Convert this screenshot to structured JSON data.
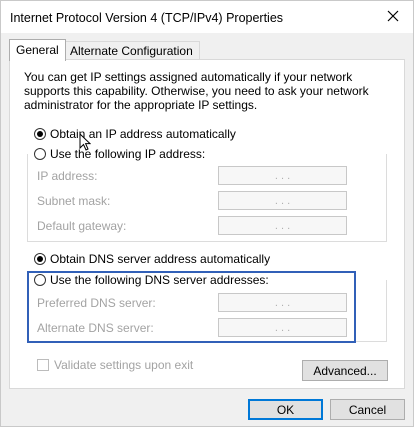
{
  "window": {
    "title": "Internet Protocol Version 4 (TCP/IPv4) Properties"
  },
  "tabs": [
    {
      "label": "General",
      "active": true
    },
    {
      "label": "Alternate Configuration",
      "active": false
    }
  ],
  "description": "You can get IP settings assigned automatically if your network supports this capability. Otherwise, you need to ask your network administrator for the appropriate IP settings.",
  "ip": {
    "auto_label": "Obtain an IP address automatically",
    "manual_label": "Use the following IP address:",
    "selected": "auto",
    "fields": [
      {
        "label": "IP address:",
        "value": ". . ."
      },
      {
        "label": "Subnet mask:",
        "value": ". . ."
      },
      {
        "label": "Default gateway:",
        "value": ". . ."
      }
    ]
  },
  "dns": {
    "auto_label": "Obtain DNS server address automatically",
    "manual_label": "Use the following DNS server addresses:",
    "selected": "auto",
    "fields": [
      {
        "label": "Preferred DNS server:",
        "value": ". . ."
      },
      {
        "label": "Alternate DNS server:",
        "value": ". . ."
      }
    ]
  },
  "validate_label": "Validate settings upon exit",
  "buttons": {
    "advanced": "Advanced...",
    "ok": "OK",
    "cancel": "Cancel"
  },
  "colors": {
    "highlight": "#3160b8",
    "default_button_border": "#0078d7"
  }
}
